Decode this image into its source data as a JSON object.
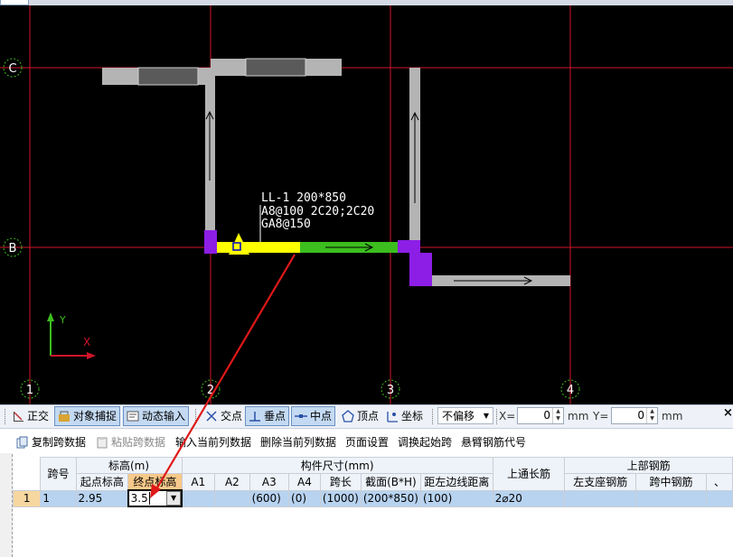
{
  "axes": {
    "rows": [
      "C",
      "B"
    ],
    "cols": [
      "1",
      "2",
      "3",
      "4"
    ]
  },
  "annotation": {
    "line1": "LL-1 200*850",
    "line2": "A8@100 2C20;2C20",
    "line3": "GA8@150"
  },
  "ucs": {
    "x_label": "X",
    "y_label": "Y"
  },
  "snap_toolbar": {
    "ortho": "正交",
    "object_snap": "对象捕捉",
    "dynamic_input": "动态输入",
    "intersection": "交点",
    "perpendicular": "垂点",
    "midpoint": "中点",
    "vertex": "顶点",
    "coordinate": "坐标",
    "offset_select": "不偏移",
    "x_label": "X=",
    "x_value": "0",
    "x_unit": "mm",
    "y_label": "Y=",
    "y_value": "0",
    "y_unit": "mm"
  },
  "command_bar": {
    "copy_span": "复制跨数据",
    "paste_span": "粘贴跨数据",
    "input_current_col": "输入当前列数据",
    "delete_current_col": "删除当前列数据",
    "page_setup": "页面设置",
    "swap_start_span": "调换起始跨",
    "cantilever_code": "悬臂钢筋代号"
  },
  "grid": {
    "headers": {
      "span_no": "跨号",
      "elevation": "标高(m)",
      "start_elev": "起点标高",
      "end_elev": "终点标高",
      "member_size": "构件尺寸(mm)",
      "a1": "A1",
      "a2": "A2",
      "a3": "A3",
      "a4": "A4",
      "span_length": "跨长",
      "section": "截面(B*H)",
      "dist_left_axis": "距左边线距离",
      "top_through": "上通长筋",
      "top_rebar": "上部钢筋",
      "left_support": "左支座钢筋",
      "mid_span": "跨中钢筋"
    },
    "row": {
      "index": "1",
      "span_no": "1",
      "start_elev": "2.95",
      "end_elev": "3.5",
      "a1": "",
      "a2": "",
      "a3": "(600)",
      "a4": "(0)",
      "span_length": "(1000)",
      "section": "(200*850)",
      "dist": "(100)",
      "top_through": "2⌀20",
      "left_support": "",
      "mid_span": ""
    }
  },
  "colors": {
    "axis_line": "#d0142a",
    "beam_gray": "#b4b4b4",
    "selected_beam": "#ffff00",
    "green_beam": "#3cbe1e",
    "support": "#8c1ee6",
    "arrow": "#e01818"
  }
}
